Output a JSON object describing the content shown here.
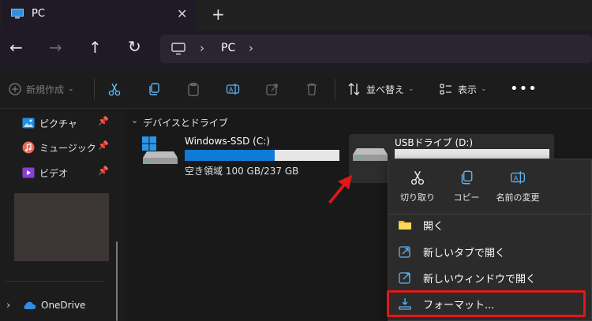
{
  "window": {
    "tab_title": "PC",
    "close_glyph": "✕",
    "new_tab_glyph": "+"
  },
  "nav": {
    "back_glyph": "←",
    "forward_glyph": "→",
    "up_glyph": "↑",
    "refresh_glyph": "↻",
    "address_sep": "›",
    "address_text": "PC"
  },
  "toolbar": {
    "new_label": "新規作成",
    "sort_label": "並べ替え",
    "view_label": "表示",
    "more_glyph": "•••"
  },
  "sidebar": {
    "items": [
      {
        "label": "ピクチャ",
        "icon": "pictures-icon"
      },
      {
        "label": "ミュージック",
        "icon": "music-icon"
      },
      {
        "label": "ビデオ",
        "icon": "videos-icon"
      }
    ],
    "onedrive_label": "OneDrive",
    "pin_glyph": "📌",
    "expand_glyph": "›"
  },
  "main": {
    "group_label": "デバイスとドライブ",
    "group_chevron": "⌄",
    "drives": [
      {
        "name": "Windows-SSD (C:)",
        "free_text": "空き領域 100 GB/237 GB",
        "used_fraction": 0.58
      },
      {
        "name": "USBドライブ (D:)",
        "free_text": "",
        "used_fraction": 0.0
      }
    ]
  },
  "context_menu": {
    "quick": [
      {
        "label": "切り取り",
        "icon": "cut-icon"
      },
      {
        "label": "コピー",
        "icon": "copy-icon"
      },
      {
        "label": "名前の変更",
        "icon": "rename-icon"
      }
    ],
    "items": [
      {
        "label": "開く",
        "icon": "folder-icon"
      },
      {
        "label": "新しいタブで開く",
        "icon": "open-new-tab-icon"
      },
      {
        "label": "新しいウィンドウで開く",
        "icon": "open-new-window-icon"
      },
      {
        "label": "フォーマット...",
        "icon": "format-icon"
      }
    ]
  },
  "colors": {
    "accent": "#0f7ad8",
    "annotation_red": "#e01818"
  }
}
